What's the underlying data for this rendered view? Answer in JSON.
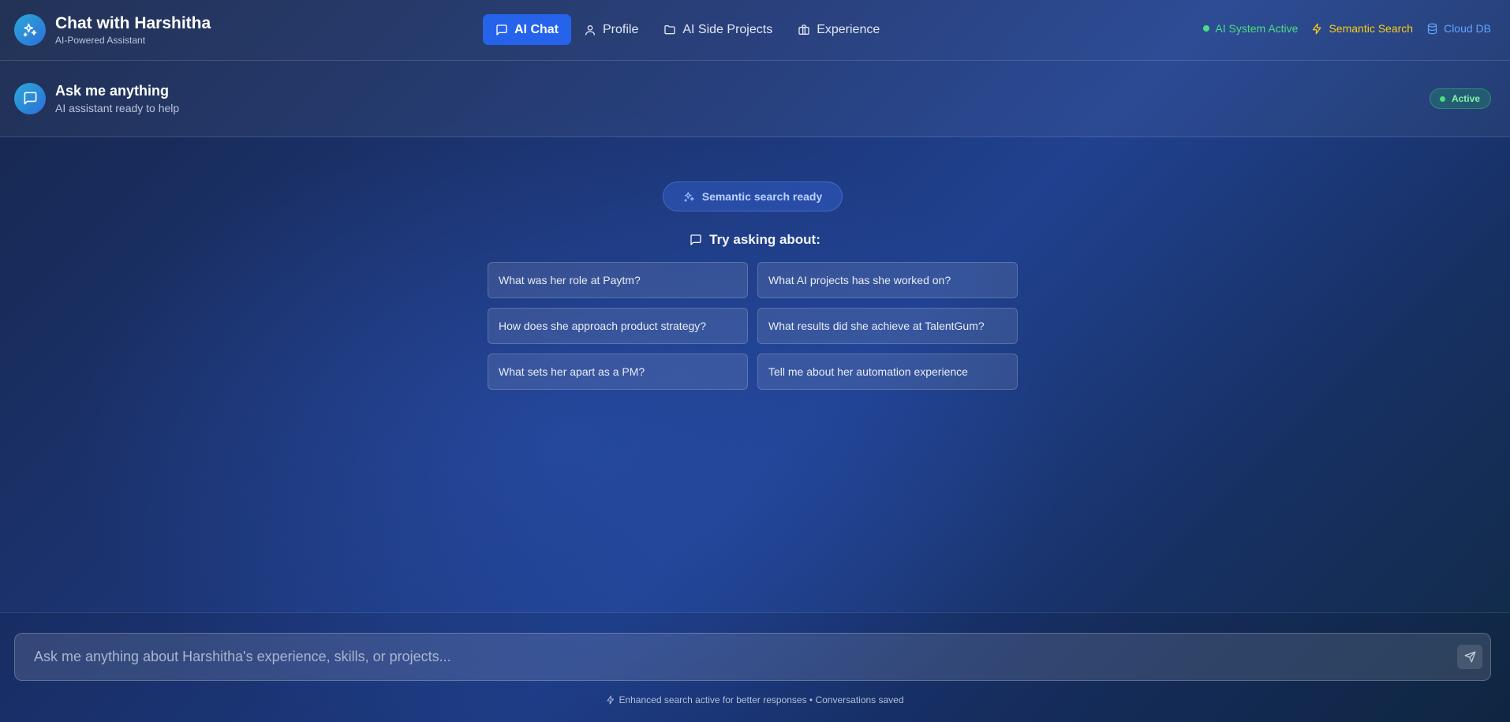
{
  "header": {
    "title": "Chat with Harshitha",
    "subtitle": "AI-Powered Assistant",
    "logo_icon": "sparkles-icon"
  },
  "nav": {
    "items": [
      {
        "label": "AI Chat",
        "icon": "message-icon",
        "active": true
      },
      {
        "label": "Profile",
        "icon": "user-icon",
        "active": false
      },
      {
        "label": "AI Side Projects",
        "icon": "folder-icon",
        "active": false
      },
      {
        "label": "Experience",
        "icon": "briefcase-icon",
        "active": false
      }
    ],
    "active_color": "#2563eb"
  },
  "status": {
    "ai_system": {
      "label": "AI System Active",
      "color": "#4ade80"
    },
    "semantic_search": {
      "label": "Semantic Search",
      "color": "#facc15",
      "icon": "bolt-icon"
    },
    "cloud_db": {
      "label": "Cloud DB",
      "color": "#60a5fa",
      "icon": "database-icon"
    }
  },
  "chat_header": {
    "title": "Ask me anything",
    "subtitle": "AI assistant ready to help",
    "badge": "Active",
    "icon": "chat-bubble-icon"
  },
  "main": {
    "ready_label": "Semantic search ready",
    "try_label": "Try asking about:",
    "suggestions": [
      "What was her role at Paytm?",
      "What AI projects has she worked on?",
      "How does she approach product strategy?",
      "What results did she achieve at TalentGum?",
      "What sets her apart as a PM?",
      "Tell me about her automation experience"
    ]
  },
  "input": {
    "placeholder": "Ask me anything about Harshitha's experience, skills, or projects...",
    "value": "",
    "send_icon": "send-icon"
  },
  "footer": {
    "note": "Enhanced search active for better responses • Conversations saved"
  }
}
